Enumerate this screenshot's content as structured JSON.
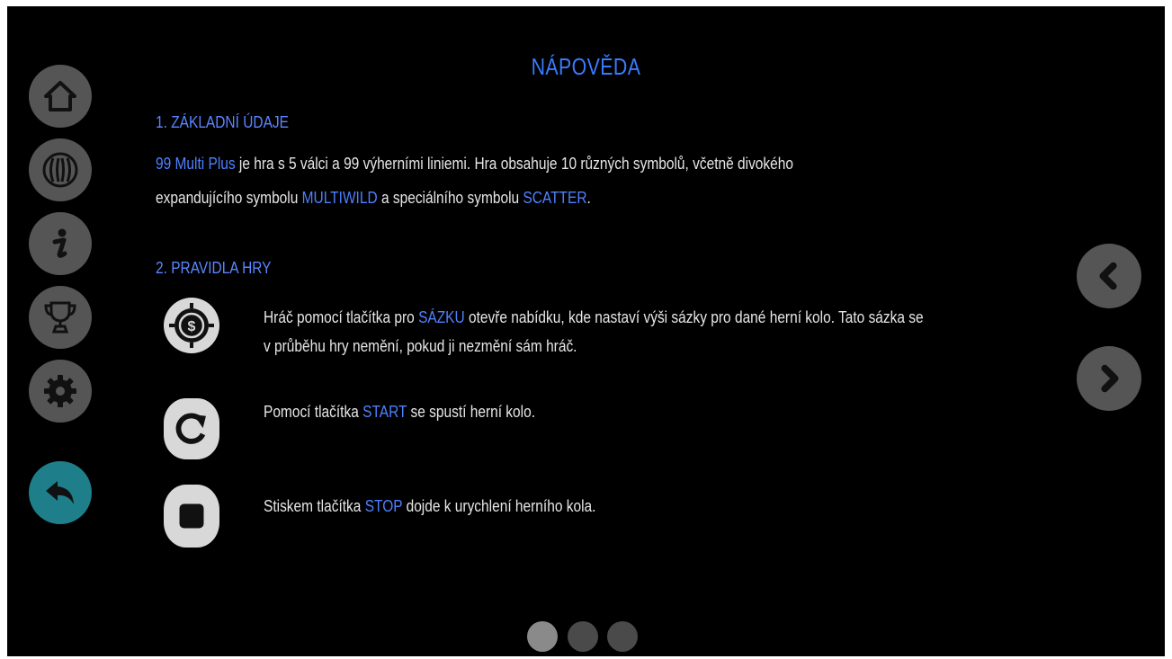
{
  "title": "NÁPOVĚDA",
  "sidebar": {
    "items": [
      {
        "name": "home",
        "icon": "home-icon"
      },
      {
        "name": "game",
        "icon": "game-logo-icon"
      },
      {
        "name": "info",
        "icon": "info-icon"
      },
      {
        "name": "trophy",
        "icon": "trophy-icon"
      },
      {
        "name": "settings",
        "icon": "gear-icon"
      },
      {
        "name": "back",
        "icon": "back-arrow-icon",
        "active": true
      }
    ]
  },
  "section1": {
    "heading": "1. ZÁKLADNÍ ÚDAJE",
    "line1_hl1": "99 Multi Plus",
    "line1_text": " je hra s 5 válci a 99 výherními liniemi. Hra obsahuje 10 různých symbolů, včetně divokého",
    "line2_text1": "expandujícího symbolu ",
    "line2_hl1": "MULTIWILD",
    "line2_text2": " a speciálního symbolu ",
    "line2_hl2": "SCATTER",
    "line2_text3": "."
  },
  "section2": {
    "heading": "2. PRAVIDLA HRY",
    "rule1_text1": "Hráč pomocí tlačítka pro ",
    "rule1_hl": "SÁZKU",
    "rule1_text2": " otevře nabídku, kde nastaví výši sázky pro dané herní kolo. Tato sázka se",
    "rule1_line2": "v průběhu hry nemění, pokud ji nezmění sám hráč.",
    "rule2_text1": "Pomocí tlačítka ",
    "rule2_hl": "START",
    "rule2_text2": " se spustí herní kolo.",
    "rule3_text1": "Stiskem tlačítka ",
    "rule3_hl": "STOP",
    "rule3_text2": " dojde k urychlení herního kola."
  },
  "nav": {
    "prev_icon": "chevron-left-icon",
    "next_icon": "chevron-right-icon"
  },
  "pagination": {
    "pages": 3,
    "current": 1
  },
  "colors": {
    "accent": "#3a7bff",
    "active_button": "#1e7f8a",
    "button": "#555555"
  }
}
